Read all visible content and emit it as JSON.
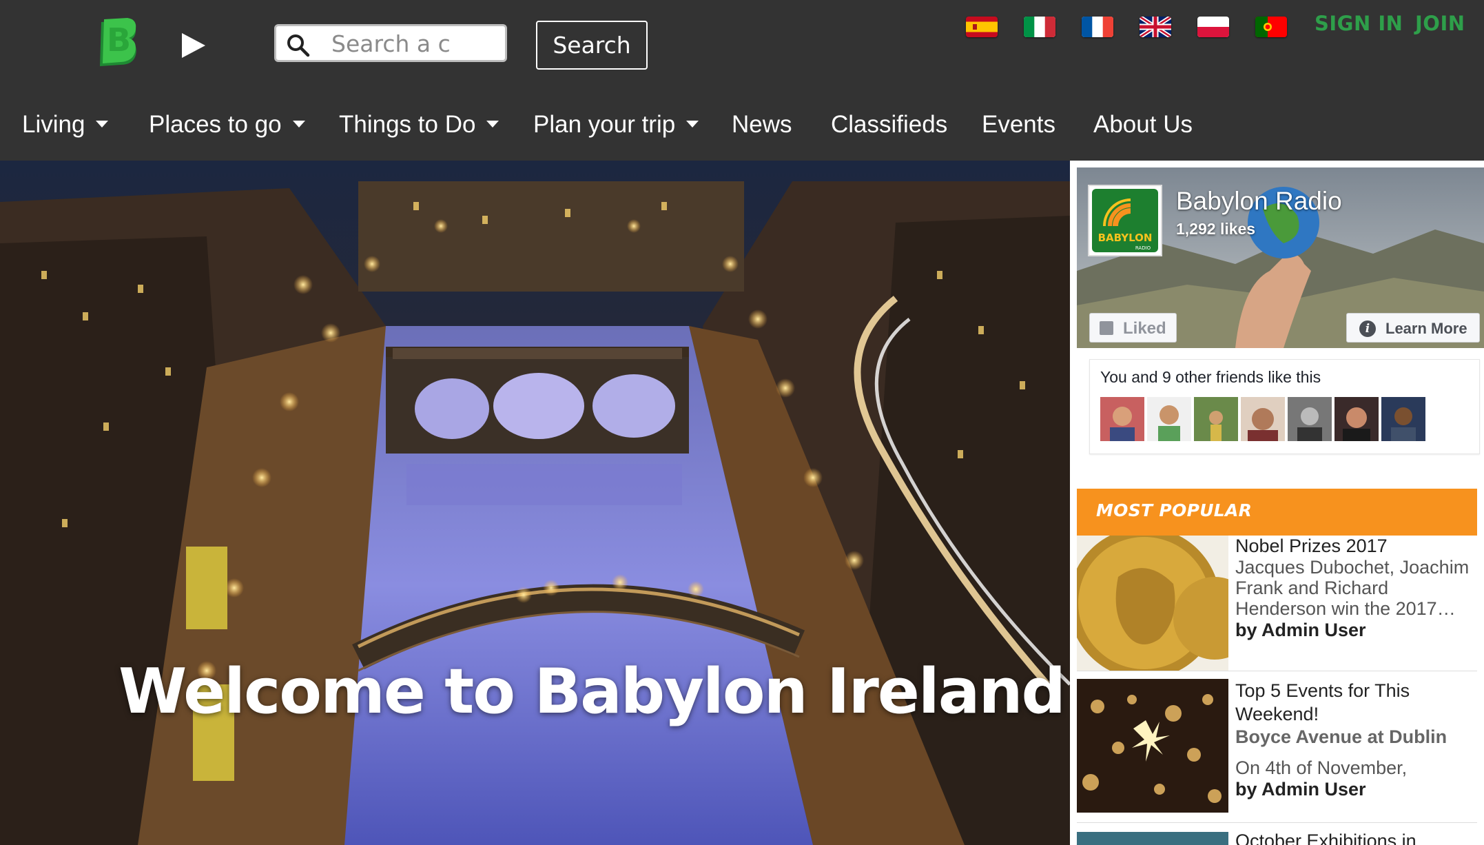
{
  "header": {
    "logo_letter": "B",
    "search": {
      "placeholder": "Search a c",
      "value": ""
    },
    "search_button": "Search",
    "languages": [
      {
        "name": "spain-flag"
      },
      {
        "name": "italy-flag"
      },
      {
        "name": "france-flag"
      },
      {
        "name": "uk-flag"
      },
      {
        "name": "poland-flag"
      },
      {
        "name": "portugal-flag"
      }
    ],
    "sign_in": "SIGN IN",
    "join": "JOIN",
    "accent_color": "#2e9f4a",
    "background_color": "#333333"
  },
  "nav": {
    "items": [
      {
        "label": "Living",
        "dropdown": true
      },
      {
        "label": "Places to go",
        "dropdown": true
      },
      {
        "label": "Things to Do",
        "dropdown": true
      },
      {
        "label": "Plan your trip",
        "dropdown": true
      },
      {
        "label": "News",
        "dropdown": false
      },
      {
        "label": "Classifieds",
        "dropdown": false
      },
      {
        "label": "Events",
        "dropdown": false
      },
      {
        "label": "About Us",
        "dropdown": false
      }
    ]
  },
  "hero": {
    "title": "Welcome to Babylon Ireland"
  },
  "facebook": {
    "page_name": "Babylon Radio",
    "likes": "1,292 likes",
    "avatar_text": "BABYLON",
    "avatar_subtext": "RADIO",
    "liked_label": "Liked",
    "learn_more_label": "Learn More",
    "friends_text": "You and 9 other friends like this"
  },
  "most_popular": {
    "title": "MOST POPULAR",
    "color": "#f7921e",
    "articles": [
      {
        "title": "Nobel Prizes 2017",
        "excerpt": "Jacques Dubochet, Joachim Frank and Richard Henderson win the 2017…",
        "by": "by",
        "author": "Admin User"
      },
      {
        "title": "Top 5 Events for This Weekend!",
        "subtitle": "Boyce Avenue at Dublin",
        "excerpt": "On 4th of November,",
        "by": "by",
        "author": "Admin User"
      },
      {
        "title": "October Exhibitions in"
      }
    ]
  }
}
